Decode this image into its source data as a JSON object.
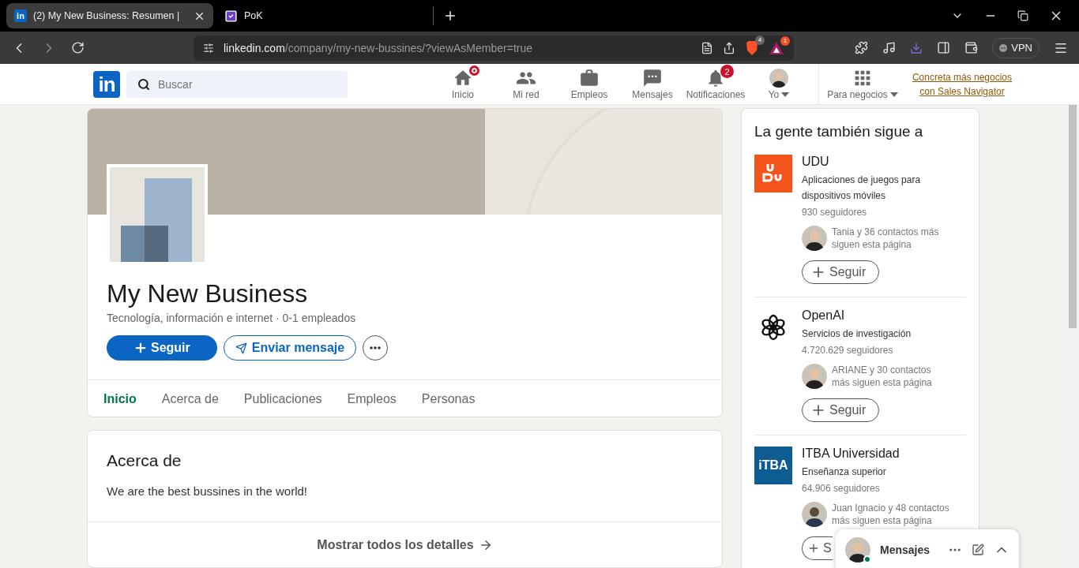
{
  "browser": {
    "tabs": [
      {
        "title": "(2) My New Business: Resumen |",
        "selected": true,
        "kind": "linkedin",
        "icon_text": "in"
      },
      {
        "title": "PoK",
        "selected": false,
        "kind": "pok"
      }
    ],
    "address": {
      "host": "linkedin.com",
      "path": "/company/my-new-bussines/?viewAsMember=true"
    },
    "shields_count": "4",
    "rewards_count": "1",
    "vpn_label": "VPN"
  },
  "nav": {
    "logo_text": "in",
    "search_placeholder": "Buscar",
    "items": [
      {
        "kind": "home",
        "label": "Inicio",
        "dot": true
      },
      {
        "kind": "network",
        "label": "Mi red",
        "dot": false
      },
      {
        "kind": "jobs",
        "label": "Empleos",
        "dot": false
      },
      {
        "kind": "messages",
        "label": "Mensajes",
        "dot": false
      },
      {
        "kind": "notifications",
        "label": "Notificaciones",
        "dot": false,
        "badge": "2"
      },
      {
        "kind": "me",
        "label": "Yo",
        "dot": false
      }
    ],
    "business_label": "Para negocios",
    "promo": "Concreta más negocios con Sales Navigator"
  },
  "company": {
    "name": "My New Business",
    "subtitle": "Tecnología, información e internet · 0-1 empleados",
    "follow_label": "Seguir",
    "message_label": "Enviar mensaje",
    "tabs": [
      {
        "label": "Inicio",
        "selected": true
      },
      {
        "label": "Acerca de",
        "selected": false
      },
      {
        "label": "Publicaciones",
        "selected": false
      },
      {
        "label": "Empleos",
        "selected": false
      },
      {
        "label": "Personas",
        "selected": false
      }
    ]
  },
  "about": {
    "title": "Acerca de",
    "text": "We are the best bussines in the world!",
    "link": "Mostrar todos los detalles"
  },
  "sidebar": {
    "title": "La gente también sigue a",
    "items": [
      {
        "kind": "udu",
        "name": "UDU",
        "description": "Aplicaciones de juegos para dispositivos móviles",
        "followers": "930 seguidores",
        "contacts": "Tania y 36 contactos más siguen esta página",
        "follow_label": "Seguir"
      },
      {
        "kind": "openai",
        "name": "OpenAI",
        "description": "Servicios de investigación",
        "followers": "4.720.629 seguidores",
        "contacts": "ARIANE y 30 contactos más siguen esta página",
        "follow_label": "Seguir"
      },
      {
        "kind": "itba",
        "logo_text": "iTBA",
        "name": "ITBA Universidad",
        "description": "Enseñanza superior",
        "followers": "64.906 seguidores",
        "contacts": "Juan Ignacio y 48 contactos más siguen esta página",
        "follow_label": "S"
      }
    ]
  },
  "messaging": {
    "title": "Mensajes",
    "online": true
  }
}
